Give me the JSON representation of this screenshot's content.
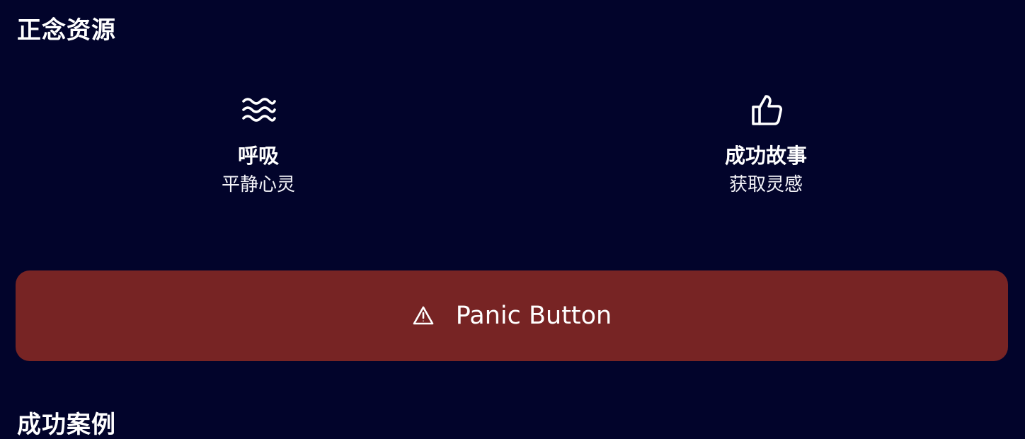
{
  "sections": {
    "resources_title": "正念资源",
    "stories_title": "成功案例"
  },
  "resources": [
    {
      "title": "呼吸",
      "subtitle": "平静心灵",
      "icon": "waves-icon"
    },
    {
      "title": "成功故事",
      "subtitle": "获取灵感",
      "icon": "thumbs-up-icon"
    }
  ],
  "panic_button": {
    "label": "Panic Button",
    "icon": "warning-icon"
  },
  "colors": {
    "background": "#02042b",
    "text": "#ffffff",
    "panic_button": "#772424"
  }
}
